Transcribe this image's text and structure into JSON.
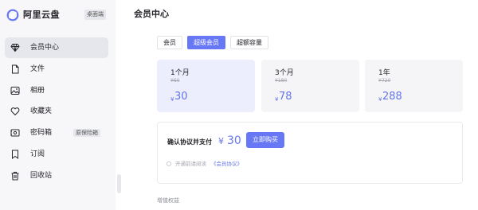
{
  "app": {
    "name": "阿里云盘",
    "platform_badge": "桌面端"
  },
  "sidebar": {
    "items": [
      {
        "label": "会员中心",
        "icon": "diamond-icon",
        "active": true
      },
      {
        "label": "文件",
        "icon": "file-icon"
      },
      {
        "label": "相册",
        "icon": "photo-icon"
      },
      {
        "label": "收藏夹",
        "icon": "heart-icon"
      },
      {
        "label": "密码箱",
        "icon": "safe-icon",
        "badge": "原保险箱"
      },
      {
        "label": "订阅",
        "icon": "bookmark-icon"
      },
      {
        "label": "回收站",
        "icon": "trash-icon"
      }
    ]
  },
  "main": {
    "title": "会员中心",
    "tabs": [
      {
        "label": "会员",
        "active": false
      },
      {
        "label": "超级会员",
        "active": true
      },
      {
        "label": "超额容量",
        "active": false
      }
    ],
    "plans": [
      {
        "duration": "1个月",
        "original": "¥60",
        "currency": "¥",
        "price": "30",
        "selected": true
      },
      {
        "duration": "3个月",
        "original": "¥180",
        "currency": "¥",
        "price": "78",
        "selected": false
      },
      {
        "duration": "1年",
        "original": "¥720",
        "currency": "¥",
        "price": "288",
        "selected": false
      }
    ],
    "confirm": {
      "text": "确认协议并支付",
      "currency": "¥",
      "price": "30",
      "button": "立即购买",
      "agreement_text": "开通前请阅读",
      "agreement_link": "《会员协议》"
    },
    "benefits_label": "增值权益"
  },
  "colors": {
    "accent": "#6878f5",
    "price": "#6475e8",
    "selected_plan_bg": "#edeefd"
  }
}
